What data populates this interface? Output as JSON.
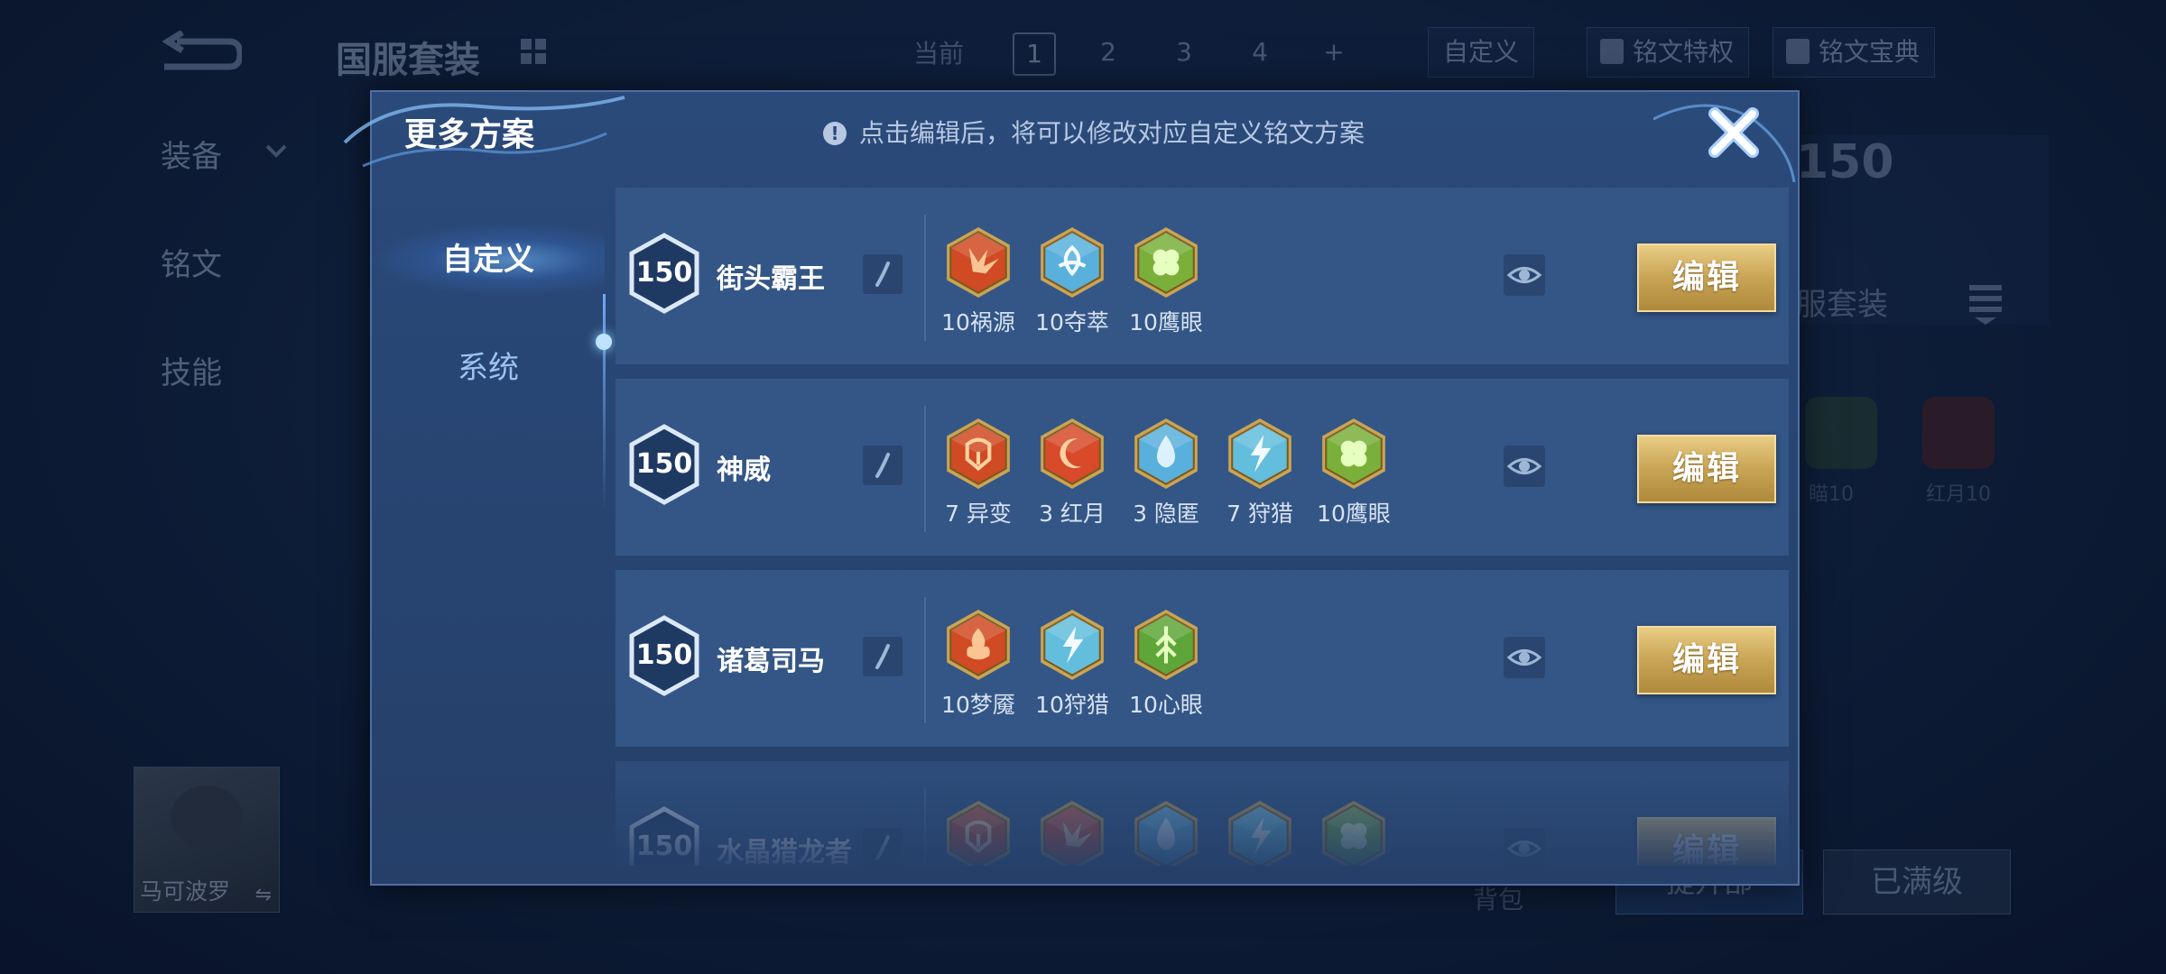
{
  "background": {
    "page_title": "国服套装",
    "current_label": "当前",
    "page_numbers": [
      "1",
      "2",
      "3",
      "4"
    ],
    "add_symbol": "+",
    "custom_label": "自定义",
    "btn_privilege": "铭文特权",
    "btn_codex": "铭文宝典",
    "side_menu": [
      "装备",
      "铭文",
      "技能"
    ],
    "hero_name": "马可波罗",
    "level_badge": "150",
    "set_name": "服套装",
    "rune_a_label": "瞄10",
    "rune_b_label": "红月10",
    "bag_label": "背包",
    "btn_upgrade": "提升部",
    "btn_maxed": "已满级"
  },
  "dialog": {
    "title": "更多方案",
    "hint": "点击编辑后，将可以修改对应自定义铭文方案",
    "hint_icon": "!",
    "tabs": [
      "自定义",
      "系统"
    ]
  },
  "plans": [
    {
      "level": "150",
      "name": "街头霸王",
      "runes": [
        {
          "label": "10祸源",
          "icon": "rune-red-claw",
          "color": "#d04a24"
        },
        {
          "label": "10夺萃",
          "icon": "rune-blue-knot",
          "color": "#5ab0dc"
        },
        {
          "label": "10鹰眼",
          "icon": "rune-green-clover",
          "color": "#7ab03a"
        }
      ],
      "edit_label": "编辑"
    },
    {
      "level": "150",
      "name": "神威",
      "runes": [
        {
          "label": "7 异变",
          "icon": "rune-red-helm",
          "color": "#d04a24"
        },
        {
          "label": "3 红月",
          "icon": "rune-red-moon",
          "color": "#d84a2a"
        },
        {
          "label": "3 隐匿",
          "icon": "rune-blue-drop",
          "color": "#5ab0dc"
        },
        {
          "label": "7 狩猎",
          "icon": "rune-blue-bolt",
          "color": "#62bedc"
        },
        {
          "label": "10鹰眼",
          "icon": "rune-green-clover",
          "color": "#7ab03a"
        }
      ],
      "edit_label": "编辑"
    },
    {
      "level": "150",
      "name": "诸葛司马",
      "runes": [
        {
          "label": "10梦魇",
          "icon": "rune-red-flame",
          "color": "#d04a24"
        },
        {
          "label": "10狩猎",
          "icon": "rune-blue-bolt",
          "color": "#62bedc"
        },
        {
          "label": "10心眼",
          "icon": "rune-green-leaf",
          "color": "#5fa63a"
        }
      ],
      "edit_label": "编辑"
    },
    {
      "level": "150",
      "name": "水晶猎龙者",
      "runes": [
        {
          "label": "",
          "icon": "rune-red-helm",
          "color": "#d04a24"
        },
        {
          "label": "",
          "icon": "rune-red-claw",
          "color": "#d84a2a"
        },
        {
          "label": "",
          "icon": "rune-blue-drop",
          "color": "#5ab0dc"
        },
        {
          "label": "",
          "icon": "rune-blue-bolt",
          "color": "#62bedc"
        },
        {
          "label": "",
          "icon": "rune-green-clover",
          "color": "#7ab03a"
        }
      ],
      "edit_label": "编辑"
    }
  ],
  "colors": {
    "gold_button": "#c9a455",
    "row_bg": "#335686",
    "dialog_bg": "#2a4a7a"
  }
}
